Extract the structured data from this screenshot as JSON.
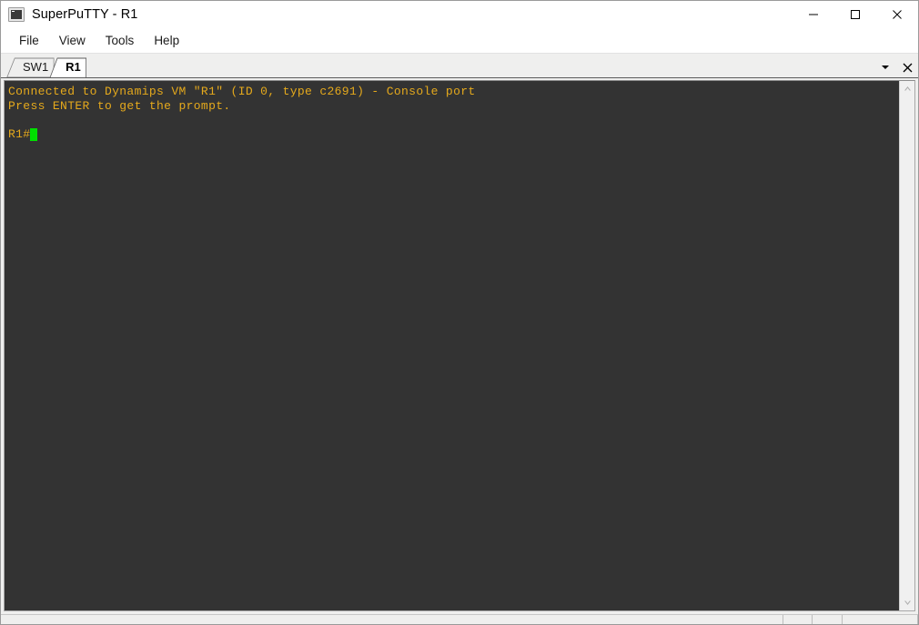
{
  "window": {
    "title": "SuperPuTTY - R1",
    "icon": "terminal-monitor-icon",
    "controls": {
      "minimize": "minimize-icon",
      "maximize": "maximize-icon",
      "close": "close-icon"
    }
  },
  "menubar": {
    "items": [
      {
        "label": "File"
      },
      {
        "label": "View"
      },
      {
        "label": "Tools"
      },
      {
        "label": "Help"
      }
    ]
  },
  "tabstrip": {
    "tabs": [
      {
        "label": "SW1",
        "active": false
      },
      {
        "label": "R1",
        "active": true
      }
    ],
    "controls": {
      "dropdown": "chevron-down-icon",
      "close": "close-icon"
    }
  },
  "terminal": {
    "lines": [
      "Connected to Dynamips VM \"R1\" (ID 0, type c2691) - Console port",
      "Press ENTER to get the prompt.",
      "",
      ""
    ],
    "prompt": "R1#",
    "cursor": "block-cursor",
    "colors": {
      "background": "#333333",
      "foreground": "#e5a91c",
      "cursor": "#00e000"
    }
  },
  "scrollbar": {
    "up_arrow": "chevron-up-icon",
    "down_arrow": "chevron-down-icon"
  }
}
